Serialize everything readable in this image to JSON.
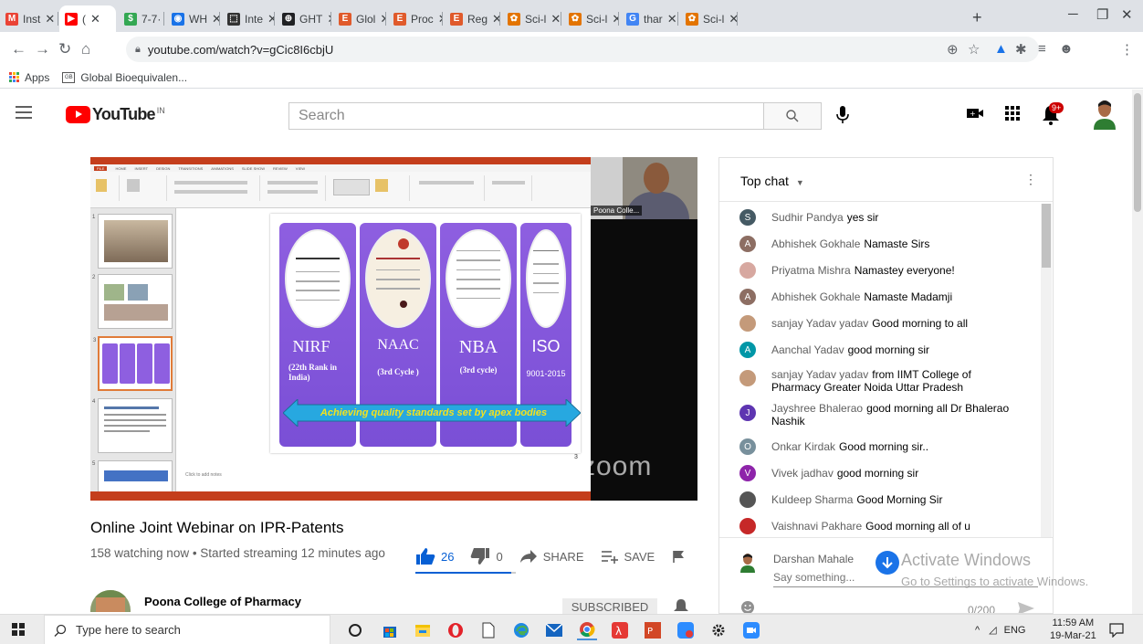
{
  "browser": {
    "tabs": [
      {
        "label": "Inst",
        "color": "#ea4335",
        "glyph": "M"
      },
      {
        "label": "(",
        "color": "#ff0000",
        "glyph": "▶",
        "active": true
      },
      {
        "label": "7-7·",
        "color": "#34a853",
        "glyph": "$"
      },
      {
        "label": "WH",
        "color": "#1a73e8",
        "glyph": "◉"
      },
      {
        "label": "Inte",
        "color": "#333333",
        "glyph": "⬚"
      },
      {
        "label": "GHT",
        "color": "#202124",
        "glyph": "⊕"
      },
      {
        "label": "Glol",
        "color": "#e05a2b",
        "glyph": "E"
      },
      {
        "label": "Proc",
        "color": "#e05a2b",
        "glyph": "E"
      },
      {
        "label": "Reg",
        "color": "#e05a2b",
        "glyph": "E"
      },
      {
        "label": "Sci-l",
        "color": "#e37400",
        "glyph": "✿"
      },
      {
        "label": "Sci-l",
        "color": "#e37400",
        "glyph": "✿"
      },
      {
        "label": "thar",
        "color": "#4285f4",
        "glyph": "G"
      },
      {
        "label": "Sci-l",
        "color": "#e37400",
        "glyph": "✿"
      }
    ],
    "new_tab": "+",
    "url": "youtube.com/watch?v=gCic8I6cbjU",
    "bookmarks": [
      {
        "label": "Apps",
        "icon": "apps-grid-icon"
      },
      {
        "label": "Global Bioequivalen...",
        "icon": "gbac-icon"
      }
    ]
  },
  "youtube": {
    "logo_text": "YouTube",
    "country_code": "IN",
    "search_placeholder": "Search",
    "notification_count": "9+"
  },
  "video": {
    "slide": {
      "cards": [
        {
          "title": "NIRF",
          "subtitle": "(22th Rank in India)"
        },
        {
          "title": "NAAC",
          "subtitle": "(3rd Cycle )"
        },
        {
          "title": "NBA",
          "subtitle": "(3rd cycle)"
        },
        {
          "title": "ISO",
          "subtitle": "9001-2015"
        }
      ],
      "banner": "Achieving quality standards set by apex bodies",
      "page_number": "3",
      "notes_placeholder": "Click to add notes"
    },
    "camera_label": "Poona Colle...",
    "watermark": "zoom",
    "title": "Online Joint Webinar on IPR-Patents",
    "meta": "158 watching now • Started streaming 12 minutes ago",
    "likes": "26",
    "dislikes": "0",
    "like_ratio": 0.95,
    "share_label": "SHARE",
    "save_label": "SAVE",
    "channel_name": "Poona College of Pharmacy",
    "subscribe_label": "SUBSCRIBED"
  },
  "chat": {
    "title": "Top chat",
    "messages": [
      {
        "author": "Sudhir Pandya",
        "text": "yes sir",
        "avatar": "S",
        "color": "#455a64"
      },
      {
        "author": "Abhishek Gokhale",
        "text": "Namaste Sirs",
        "avatar": "A",
        "color": "#8d6e63"
      },
      {
        "author": "Priyatma Mishra",
        "text": "Namastey everyone!",
        "avatar": "",
        "color": "#d7a8a0"
      },
      {
        "author": "Abhishek Gokhale",
        "text": "Namaste Madamji",
        "avatar": "A",
        "color": "#8d6e63"
      },
      {
        "author": "sanjay Yadav yadav",
        "text": "Good morning to all",
        "avatar": "",
        "color": "#c49a7a"
      },
      {
        "author": "Aanchal Yadav",
        "text": "good morning sir",
        "avatar": "A",
        "color": "#0097a7"
      },
      {
        "author": "sanjay Yadav yadav",
        "text": "from IIMT College of Pharmacy Greater Noida Uttar Pradesh",
        "avatar": "",
        "color": "#c49a7a"
      },
      {
        "author": "Jayshree Bhalerao",
        "text": "good morning all Dr Bhalerao Nashik",
        "avatar": "J",
        "color": "#5e35b1"
      },
      {
        "author": "Onkar Kirdak",
        "text": "Good morning sir..",
        "avatar": "O",
        "color": "#78909c"
      },
      {
        "author": "Vivek jadhav",
        "text": "good morning sir",
        "avatar": "V",
        "color": "#8e24aa"
      },
      {
        "author": "Kuldeep Sharma",
        "text": "Good Morning Sir",
        "avatar": "",
        "color": "#555555"
      },
      {
        "author": "Vaishnavi Pakhare",
        "text": "Good morning all of u",
        "avatar": "",
        "color": "#c62828"
      }
    ],
    "my_name": "Darshan Mahale",
    "input_placeholder": "Say something...",
    "char_count": "0/200"
  },
  "watermark": {
    "line1": "Activate Windows",
    "line2": "Go to Settings to activate Windows."
  },
  "taskbar": {
    "search_placeholder": "Type here to search",
    "language": "ENG",
    "time": "11:59 AM",
    "date": "19-Mar-21"
  }
}
